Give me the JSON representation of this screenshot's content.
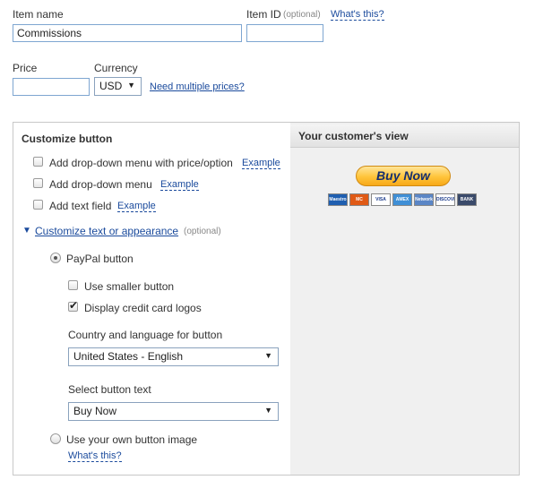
{
  "item_name": {
    "label": "Item name",
    "value": "Commissions"
  },
  "item_id": {
    "label": "Item ID",
    "optional": "(optional)",
    "help_link": "What's this?",
    "value": ""
  },
  "price": {
    "label": "Price",
    "value": ""
  },
  "currency": {
    "label": "Currency",
    "value": "USD",
    "multiple_prices_link": "Need multiple prices?"
  },
  "customize": {
    "title": "Customize button",
    "options": [
      {
        "label": "Add drop-down menu with price/option",
        "example": "Example",
        "checked": false
      },
      {
        "label": "Add drop-down menu",
        "example": "Example",
        "checked": false
      },
      {
        "label": "Add text field",
        "example": "Example",
        "checked": false
      }
    ],
    "appearance_toggle": "Customize text or appearance",
    "appearance_optional": "(optional)",
    "paypal_button_label": "PayPal button",
    "smaller_button_label": "Use smaller button",
    "credit_logos_label": "Display credit card logos",
    "country_label": "Country and language for button",
    "country_value": "United States - English",
    "button_text_label": "Select button text",
    "button_text_value": "Buy Now",
    "own_image_label": "Use your own button image",
    "own_image_help": "What's this?"
  },
  "preview": {
    "title": "Your customer's view",
    "button_text": "Buy Now",
    "cards": [
      {
        "name": "maestro-icon",
        "text": "Maestro",
        "color": "#1f5fb0"
      },
      {
        "name": "mastercard-icon",
        "text": "MC",
        "color": "#e05a16"
      },
      {
        "name": "visa-icon",
        "text": "VISA",
        "color": "#ffffff"
      },
      {
        "name": "amex-icon",
        "text": "AMEX",
        "color": "#3f8fd6"
      },
      {
        "name": "discover-network-icon",
        "text": "Network",
        "color": "#5b86c6"
      },
      {
        "name": "discover-icon",
        "text": "DISCOVER",
        "color": "#ffffff"
      },
      {
        "name": "bank-icon",
        "text": "BANK",
        "color": "#3a4a6a"
      }
    ]
  }
}
